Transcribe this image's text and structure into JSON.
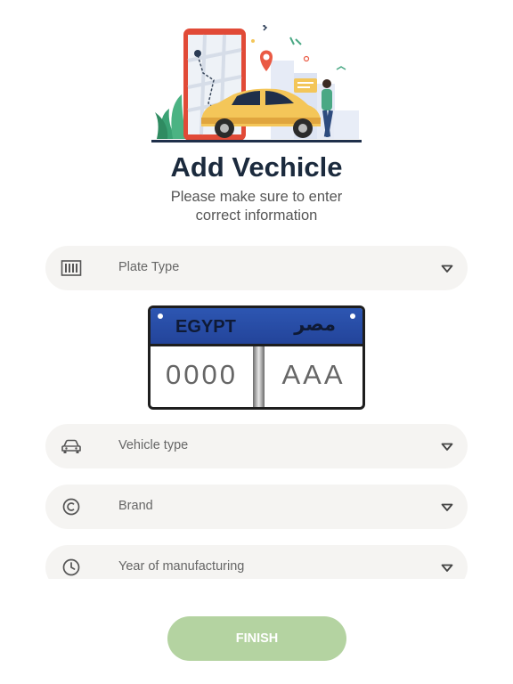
{
  "header": {
    "title": "Add Vechicle",
    "subtitle_line1": "Please make sure to enter",
    "subtitle_line2": "correct information"
  },
  "form": {
    "plate_type": {
      "label": "Plate Type",
      "icon": "barcode-icon"
    },
    "vehicle_type": {
      "label": "Vehicle type",
      "icon": "car-icon"
    },
    "brand": {
      "label": "Brand",
      "icon": "copyright-icon"
    },
    "year": {
      "label": "Year of manufacturing",
      "icon": "clock-icon"
    }
  },
  "plate": {
    "country": "EGYPT",
    "country_arabic": "مصر",
    "numbers": "0000",
    "letters": "AAA",
    "band_color": "#2b52ad"
  },
  "actions": {
    "finish_label": "FINISH"
  },
  "colors": {
    "accent": "#b4d3a1",
    "field_bg": "#f5f4f2",
    "title": "#1b2a3d"
  }
}
